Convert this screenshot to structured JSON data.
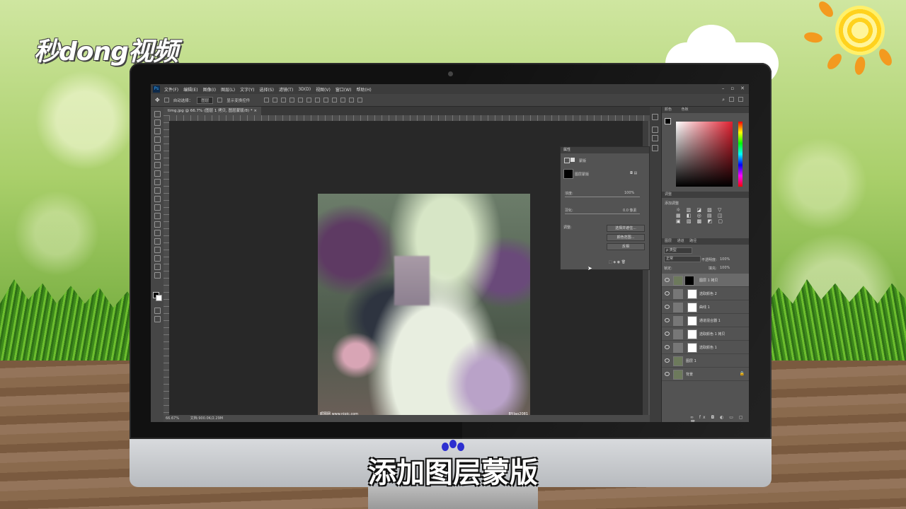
{
  "logo": {
    "text": "秒dong视频"
  },
  "caption": {
    "text": "添加图层蒙版"
  },
  "photoshop": {
    "menu": [
      "文件(F)",
      "编辑(E)",
      "图像(I)",
      "图层(L)",
      "文字(Y)",
      "选择(S)",
      "滤镜(T)",
      "3D(D)",
      "视图(V)",
      "窗口(W)",
      "帮助(H)"
    ],
    "options_bar": {
      "auto_select_label": "自动选择：",
      "auto_select_value": "图层",
      "show_transform_label": "显示变换控件"
    },
    "doc_tab": "timg.jpg @ 66.7% (图层 1 拷贝, 图层蒙版/8) *",
    "status": {
      "zoom": "66.67%",
      "doc": "文档:900.0K/2.29M"
    },
    "watermark_left": "昵图网 www.nipic.com",
    "watermark_right": "BY:lao2081",
    "properties": {
      "title": "属性",
      "tab": "蒙版",
      "mask_type": "图层蒙版",
      "density_label": "浓度:",
      "density_value": "100%",
      "feather_label": "羽化:",
      "feather_value": "0.0 像素",
      "refine_label": "调整:",
      "btn_select_mask": "选择并遮住...",
      "btn_color_range": "颜色范围...",
      "btn_invert": "反相"
    },
    "color_panel": {
      "tab1": "颜色",
      "tab2": "色板"
    },
    "adjust_panel": {
      "title": "调整",
      "subtitle": "添加调整"
    },
    "layers_panel": {
      "tabs": [
        "图层",
        "通道",
        "路径"
      ],
      "filter": "类型",
      "blend": "正常",
      "opacity_label": "不透明度:",
      "opacity": "100%",
      "lock_label": "锁定:",
      "fill_label": "填充:",
      "fill": "100%",
      "layers": [
        {
          "name": "图层 1 拷贝"
        },
        {
          "name": "选取颜色 2"
        },
        {
          "name": "曲线 1"
        },
        {
          "name": "通道混合器 1"
        },
        {
          "name": "选取颜色 1 拷贝"
        },
        {
          "name": "选取颜色 1"
        },
        {
          "name": "图层 1"
        },
        {
          "name": "背景"
        }
      ]
    }
  }
}
